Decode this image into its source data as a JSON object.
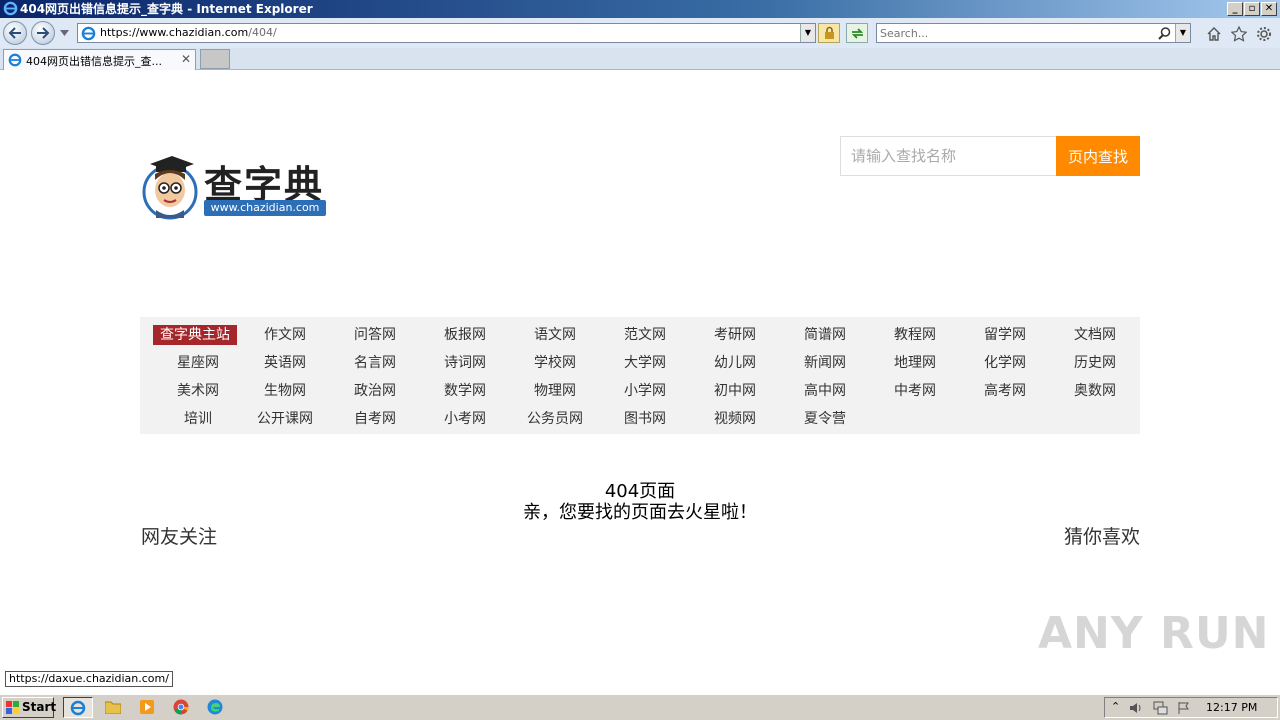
{
  "window": {
    "title": "404网页出错信息提示_查字典 - Internet Explorer",
    "minimize": "_",
    "maximize": "▫",
    "close": "✕"
  },
  "navbar": {
    "url_host": "https://www.chazidian.com",
    "url_path": "/404/",
    "search_placeholder": "Search..."
  },
  "tabs": [
    {
      "label": "404网页出错信息提示_查..."
    }
  ],
  "page": {
    "logo": {
      "brand": "查字典",
      "domain": "www.chazidian.com"
    },
    "search": {
      "placeholder": "请输入查找名称",
      "button": "页内查找"
    },
    "nav_links": [
      [
        "查字典主站",
        "作文网",
        "问答网",
        "板报网",
        "语文网",
        "范文网",
        "考研网",
        "简谱网",
        "教程网",
        "留学网",
        "文档网"
      ],
      [
        "星座网",
        "英语网",
        "名言网",
        "诗词网",
        "学校网",
        "大学网",
        "幼儿网",
        "新闻网",
        "地理网",
        "化学网",
        "历史网"
      ],
      [
        "美术网",
        "生物网",
        "政治网",
        "数学网",
        "物理网",
        "小学网",
        "初中网",
        "高中网",
        "中考网",
        "高考网",
        "奥数网"
      ],
      [
        "培训",
        "公开课网",
        "自考网",
        "小考网",
        "公务员网",
        "图书网",
        "视频网",
        "夏令营"
      ]
    ],
    "error_title": "404页面",
    "error_message": "亲，您要找的页面去火星啦！",
    "friends_title": "网友关注",
    "guess_title": "猜你喜欢",
    "status_url": "https://daxue.chazidian.com/",
    "watermark": "ANY RUN"
  },
  "taskbar": {
    "start_label": "Start",
    "clock": "12:17 PM"
  }
}
